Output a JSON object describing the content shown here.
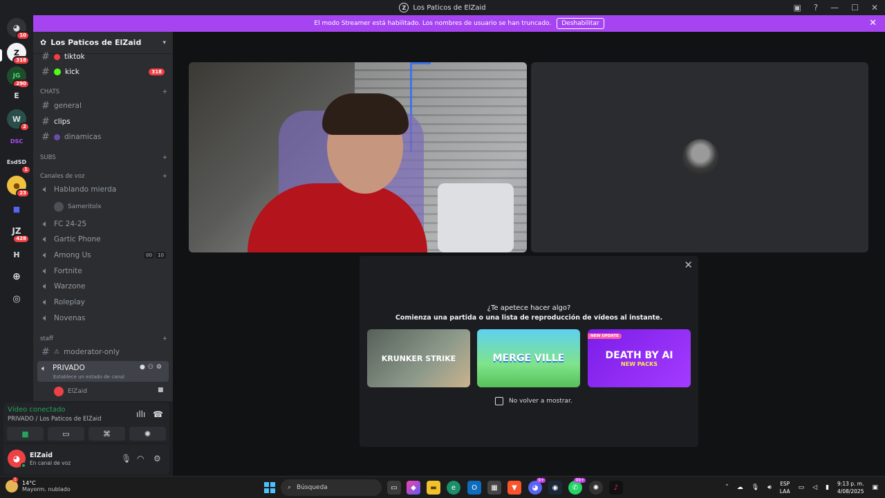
{
  "window": {
    "title": "Los Paticos de ElZaid"
  },
  "banner": {
    "text": "El modo Streamer está habilitado. Los nombres de usuario se han truncado.",
    "button": "Deshabilitar"
  },
  "rail": {
    "servers": [
      {
        "label": "",
        "badge": "10"
      },
      {
        "label": "Z",
        "badge": "318"
      },
      {
        "label": "JG",
        "badge": "290"
      },
      {
        "label": "E",
        "badge": ""
      },
      {
        "label": "W",
        "badge": "2"
      },
      {
        "label": "DSC",
        "badge": ""
      },
      {
        "label": "EsdSD",
        "badge": "1"
      },
      {
        "label": "",
        "badge": "23"
      },
      {
        "label": "",
        "badge": ""
      },
      {
        "label": "JZ",
        "badge": "428"
      },
      {
        "label": "H",
        "badge": ""
      }
    ]
  },
  "sidebar": {
    "guild_name": "Los Paticos de ElZaid",
    "top_channels": [
      {
        "name": "tiktok"
      },
      {
        "name": "kick",
        "count": "318"
      }
    ],
    "cat_chats": "CHATS",
    "chats": [
      {
        "name": "general"
      },
      {
        "name": "clips"
      },
      {
        "name": "dinamicas"
      }
    ],
    "cat_subs": "SUBS",
    "cat_voice": "Canales de voz",
    "voice": [
      {
        "name": "Hablando mierda"
      },
      {
        "name": "FC 24-25"
      },
      {
        "name": "Gartic Phone"
      },
      {
        "name": "Among Us",
        "chip_a": "00",
        "chip_b": "10"
      },
      {
        "name": "Fortnite"
      },
      {
        "name": "Warzone"
      },
      {
        "name": "Roleplay"
      },
      {
        "name": "Novenas"
      }
    ],
    "voice_user": "Sameritolx",
    "cat_staff": "staff",
    "staff": [
      {
        "name": "moderator-only"
      }
    ],
    "private": {
      "name": "PRIVADO",
      "sub": "Establece un estado de canal"
    },
    "private_user": "ElZaid"
  },
  "voice_panel": {
    "status": "Vídeo conectado",
    "location": "PRIVADO / Los Paticos de ElZaid"
  },
  "user_panel": {
    "username": "ElZaid",
    "status": "En canal de voz"
  },
  "activity": {
    "question": "¿Te apetece hacer algo?",
    "subtitle": "Comienza una partida o una lista de reproducción de vídeos al instante.",
    "cards": [
      {
        "title": "KRUNKER STRIKE"
      },
      {
        "title": "MERGE VILLE"
      },
      {
        "title": "DEATH BY AI",
        "tag": "NEW UPDATE",
        "sub": "NEW PACKS"
      }
    ],
    "checkbox": "No volver a mostrar."
  },
  "taskbar": {
    "weather_temp": "14°C",
    "weather_desc": "Mayorm. nublado",
    "weather_badge": "1",
    "search": "Búsqueda",
    "discord_badge": "9+",
    "whatsapp_badge": "99+",
    "lang_a": "ESP",
    "lang_b": "LAA",
    "time": "9:13 p. m.",
    "date": "4/08/2025"
  }
}
